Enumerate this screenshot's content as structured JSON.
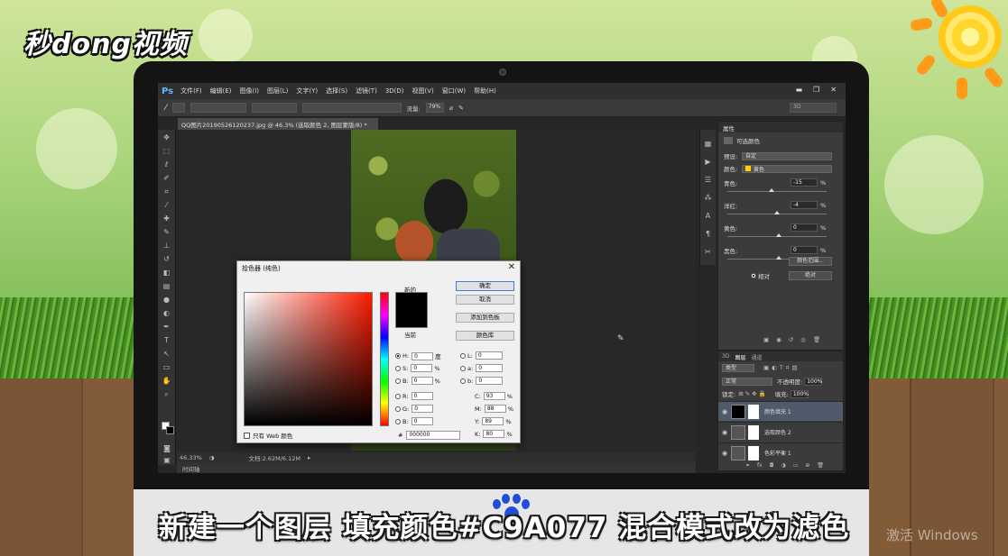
{
  "brand": {
    "logo_text": "秒dong视频"
  },
  "subtitle": "新建一个图层 填充颜色#C9A077 混合模式改为滤色",
  "watermark": "激活 Windows",
  "photoshop": {
    "app_label": "Ps",
    "menu": [
      "文件(F)",
      "编辑(E)",
      "图像(I)",
      "图层(L)",
      "文字(Y)",
      "选择(S)",
      "滤镜(T)",
      "3D(D)",
      "视图(V)",
      "窗口(W)",
      "帮助(H)"
    ],
    "options": {
      "flow_label": "流量:",
      "flow_value": "79%",
      "mode_3d": "3D"
    },
    "document_tab": "QQ图片20190526120237.jpg @ 46.3% (选取颜色 2, 图层蒙版/8) *",
    "status": {
      "zoom": "46.33%",
      "doc_size": "文档:2.62M/6.12M"
    },
    "timeline_label": "时间轴"
  },
  "properties_panel": {
    "tab": "属性",
    "title": "可选颜色",
    "preset_label": "预设:",
    "preset_value": "自定",
    "colors_label": "颜色:",
    "colors_value": "黄色",
    "sliders": [
      {
        "label": "青色:",
        "value": "-15",
        "unit": "%"
      },
      {
        "label": "洋红:",
        "value": "-4",
        "unit": "%"
      },
      {
        "label": "黄色:",
        "value": "0",
        "unit": "%"
      },
      {
        "label": "黑色:",
        "value": "0",
        "unit": "%"
      }
    ],
    "relative_label": "相对",
    "absolute_label": "绝对",
    "colors_button": "颜色范围..."
  },
  "layers_panel": {
    "tabs": [
      "3D",
      "图层",
      "通道"
    ],
    "filter_label": "类型",
    "blend_mode": "正常",
    "opacity_label": "不透明度:",
    "opacity_value": "100%",
    "lock_label": "锁定:",
    "fill_label": "填充:",
    "fill_value": "100%",
    "layers": [
      {
        "name": "颜色填充 1",
        "selected": true
      },
      {
        "name": "选取颜色 2",
        "selected": false
      },
      {
        "name": "色彩平衡 1",
        "selected": false
      }
    ]
  },
  "color_picker": {
    "title": "拾色器 (纯色)",
    "new_label": "新的",
    "current_label": "当前",
    "buttons": {
      "ok": "确定",
      "cancel": "取消",
      "add_swatch": "添加到色板",
      "libraries": "颜色库"
    },
    "web_only_label": "只有 Web 颜色",
    "hsb": [
      {
        "label": "H:",
        "value": "0",
        "unit": "度"
      },
      {
        "label": "S:",
        "value": "0",
        "unit": "%"
      },
      {
        "label": "B:",
        "value": "0",
        "unit": "%"
      }
    ],
    "rgb": [
      {
        "label": "R:",
        "value": "0"
      },
      {
        "label": "G:",
        "value": "0"
      },
      {
        "label": "B:",
        "value": "0"
      }
    ],
    "lab": [
      {
        "label": "L:",
        "value": "0"
      },
      {
        "label": "a:",
        "value": "0"
      },
      {
        "label": "b:",
        "value": "0"
      }
    ],
    "cmyk": [
      {
        "label": "C:",
        "value": "93",
        "unit": "%"
      },
      {
        "label": "M:",
        "value": "88",
        "unit": "%"
      },
      {
        "label": "Y:",
        "value": "89",
        "unit": "%"
      },
      {
        "label": "K:",
        "value": "80",
        "unit": "%"
      }
    ],
    "hex_label": "#",
    "hex_value": "000000"
  }
}
